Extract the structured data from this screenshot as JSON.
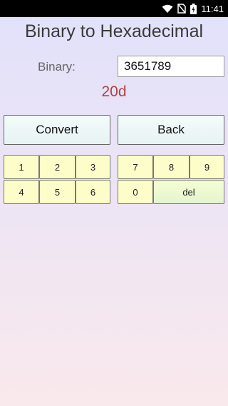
{
  "status_bar": {
    "time": "11:41",
    "icons": [
      "wifi-icon",
      "no-sim-icon",
      "battery-charging-icon"
    ]
  },
  "app": {
    "title": "Binary to Hexadecimal"
  },
  "form": {
    "binary_label": "Binary:",
    "binary_value": "3651789",
    "result": "20d"
  },
  "buttons": {
    "convert": "Convert",
    "back": "Back"
  },
  "keypad": {
    "left": [
      "1",
      "2",
      "3",
      "4",
      "5",
      "6"
    ],
    "right": [
      "7",
      "8",
      "9",
      "0"
    ],
    "delete": "del"
  },
  "colors": {
    "result_text": "#b04040",
    "key_background": "#fdfdc9",
    "button_background": "#e7f3f3"
  }
}
